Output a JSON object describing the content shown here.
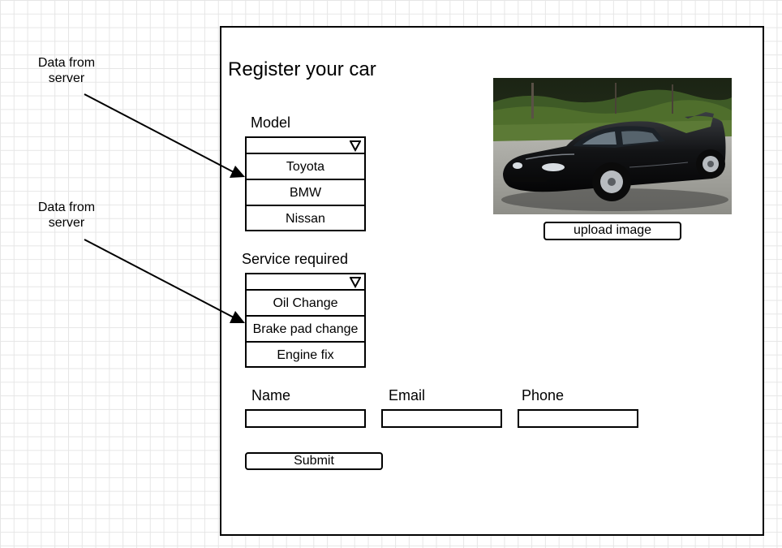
{
  "form": {
    "title": "Register your car",
    "model_label": "Model",
    "model_options": [
      "Toyota",
      "BMW",
      "Nissan"
    ],
    "service_label": "Service required",
    "service_options": [
      "Oil Change",
      "Brake pad change",
      "Engine fix"
    ],
    "name_label": "Name",
    "email_label": "Email",
    "phone_label": "Phone",
    "name_value": "",
    "email_value": "",
    "phone_value": "",
    "submit_label": "Submit",
    "upload_label": "upload image"
  },
  "annotations": {
    "model_note_line1": "Data from",
    "model_note_line2": "server",
    "service_note_line1": "Data from",
    "service_note_line2": "server"
  },
  "icons": {
    "dropdown_toggle": "triangle-down-icon",
    "arrow": "arrow-right-icon"
  },
  "colors": {
    "grid": "#e6e6e6",
    "stroke": "#000000",
    "background": "#ffffff"
  }
}
